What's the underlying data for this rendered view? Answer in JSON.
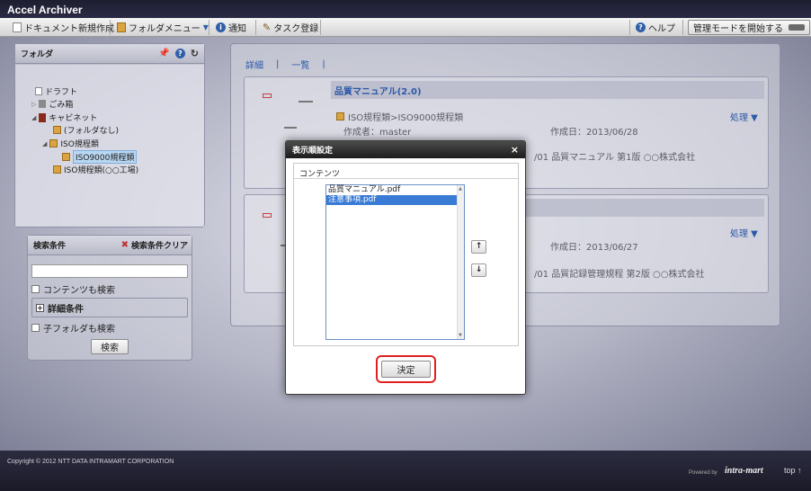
{
  "app": {
    "title": "Accel Archiver"
  },
  "toolbar": {
    "new_doc": "ドキュメント新規作成",
    "folder_menu": "フォルダメニュー",
    "notify": "通知",
    "task": "タスク登録",
    "help": "ヘルプ",
    "admin_mode": "管理モードを開始する"
  },
  "folder_panel": {
    "title": "フォルダ",
    "items": [
      {
        "label": "ドラフト",
        "icon": "draft-icon"
      },
      {
        "label": "ごみ箱",
        "icon": "trash-icon"
      },
      {
        "label": "キャビネット",
        "icon": "cabinet-icon"
      },
      {
        "label": "(フォルダなし)",
        "icon": "folder-icon"
      },
      {
        "label": "ISO規程類",
        "icon": "folder-icon"
      },
      {
        "label": "ISO9000規程類",
        "icon": "folder-icon",
        "selected": true
      },
      {
        "label": "ISO規程類(○○工場)",
        "icon": "folder-icon"
      }
    ]
  },
  "search_panel": {
    "title": "検索条件",
    "clear": "検索条件クリア",
    "input_value": "",
    "content_search": "コンテンツも検索",
    "advanced": "詳細条件",
    "subfolder_search": "子フォルダも検索",
    "search_button": "検索"
  },
  "main": {
    "tabs": [
      "詳細",
      "一覧"
    ],
    "card1": {
      "title": "品質マニュアル(2.0)",
      "path": "ISO規程類>ISO9000規程類",
      "action": "処理",
      "author": "作成者：master",
      "created": "作成日：2013/06/28",
      "desc": "/01 品質マニュアル 第1版 ○○株式会社"
    },
    "card2": {
      "action": "処理",
      "created": "作成日：2013/06/27",
      "desc": "/01 品質記録管理規程 第2版 ○○株式会社"
    }
  },
  "modal": {
    "title": "表示順設定",
    "section": "コンテンツ",
    "options": [
      "品質マニュアル.pdf",
      "注意事項.pdf"
    ],
    "selected_index": 1,
    "up": "↑",
    "down": "↓",
    "confirm": "決定",
    "close": "×"
  },
  "footer": {
    "copyright": "Copyright © 2012 NTT DATA INTRAMART CORPORATION",
    "powered": "Powered by",
    "brand": "intra-mart",
    "top": "top ↑"
  },
  "colors": {
    "accent_blue": "#2b58a8",
    "highlight_red": "#e02020",
    "selection": "#3a7bd5"
  }
}
